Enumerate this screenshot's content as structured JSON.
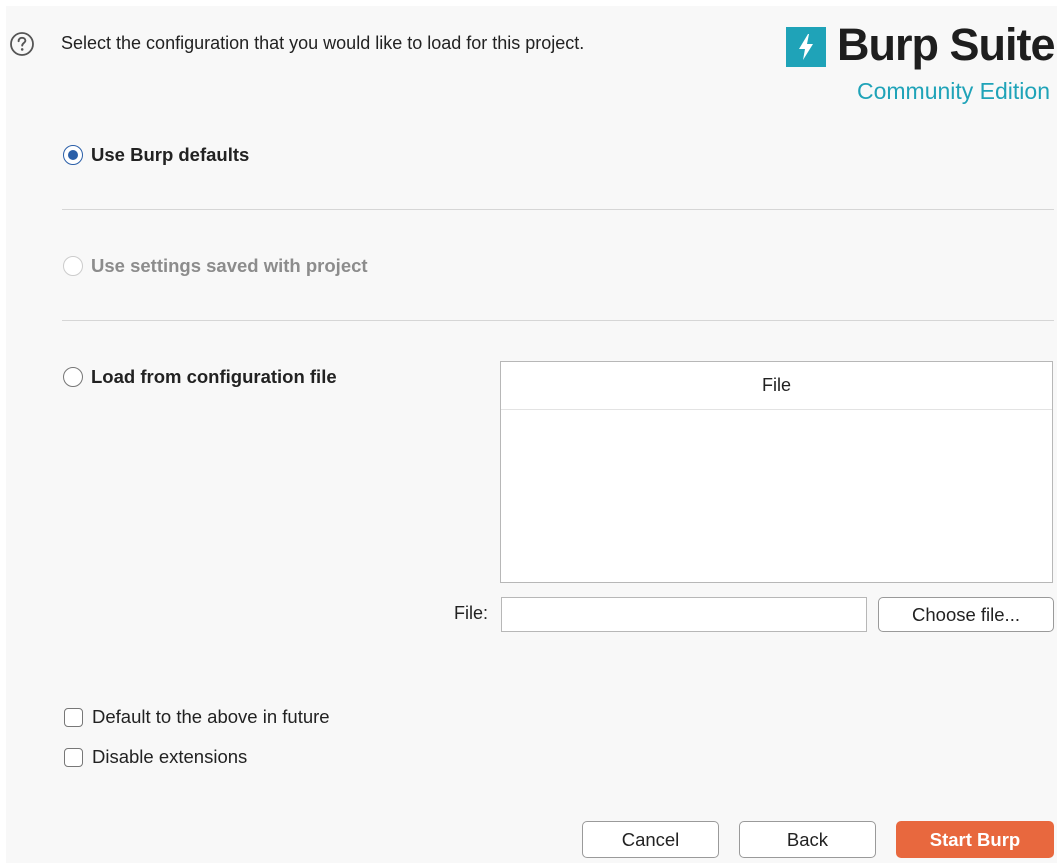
{
  "header": {
    "intro_text": "Select the configuration that you would like to load for this project.",
    "help_icon": "question-circle-icon"
  },
  "logo": {
    "title": "Burp Suite",
    "subtitle": "Community Edition",
    "mark_icon": "lightning-bolt-icon"
  },
  "options": {
    "use_defaults": {
      "label": "Use Burp defaults",
      "selected": true
    },
    "use_saved": {
      "label": "Use settings saved with project",
      "disabled": true
    },
    "load_from_file": {
      "label": "Load from configuration file",
      "selected": false
    }
  },
  "file_table": {
    "column_header": "File"
  },
  "file_field": {
    "label": "File:",
    "value": "",
    "choose_button": "Choose file..."
  },
  "checkboxes": {
    "default_future": {
      "label": "Default to the above in future",
      "checked": false
    },
    "disable_extensions": {
      "label": "Disable extensions",
      "checked": false
    }
  },
  "buttons": {
    "cancel": "Cancel",
    "back": "Back",
    "start": "Start Burp"
  },
  "colors": {
    "accent": "#2b5fa8",
    "brand_teal": "#1fa3b8",
    "start_button": "#e8683e"
  }
}
